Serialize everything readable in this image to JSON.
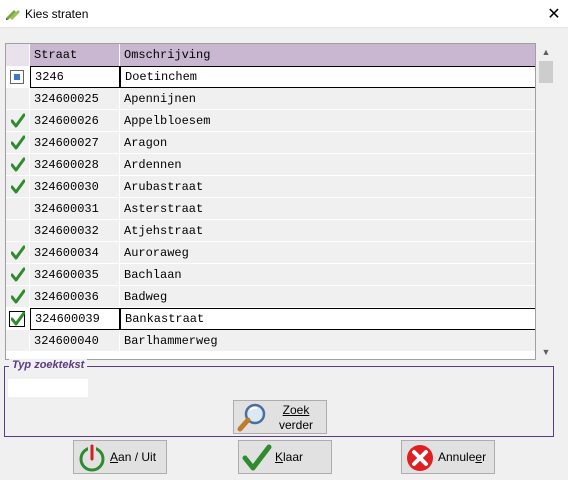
{
  "window": {
    "title": "Kies straten",
    "close_glyph": "✕"
  },
  "grid": {
    "columns": [
      "Straat",
      "Omschrijving"
    ],
    "rows": [
      {
        "straat": "3246",
        "omschrijving": "Doetinchem",
        "mark": "current"
      },
      {
        "straat": "324600025",
        "omschrijving": "Apennijnen",
        "mark": "none"
      },
      {
        "straat": "324600026",
        "omschrijving": "Appelbloesem",
        "mark": "check"
      },
      {
        "straat": "324600027",
        "omschrijving": "Aragon",
        "mark": "check"
      },
      {
        "straat": "324600028",
        "omschrijving": "Ardennen",
        "mark": "check"
      },
      {
        "straat": "324600030",
        "omschrijving": "Arubastraat",
        "mark": "check"
      },
      {
        "straat": "324600031",
        "omschrijving": "Asterstraat",
        "mark": "none"
      },
      {
        "straat": "324600032",
        "omschrijving": "Atjehstraat",
        "mark": "none"
      },
      {
        "straat": "324600034",
        "omschrijving": "Auroraweg",
        "mark": "check"
      },
      {
        "straat": "324600035",
        "omschrijving": "Bachlaan",
        "mark": "check"
      },
      {
        "straat": "324600036",
        "omschrijving": "Badweg",
        "mark": "check"
      },
      {
        "straat": "324600039",
        "omschrijving": "Bankastraat",
        "mark": "check-selected"
      },
      {
        "straat": "324600040",
        "omschrijving": "Barlhammerweg",
        "mark": "none"
      }
    ]
  },
  "search": {
    "legend": "Typ zoektekst",
    "value": "",
    "button_line1": "Zoek",
    "button_line2": "verder",
    "icon": "magnifier-icon"
  },
  "buttons": {
    "aan_uit": "Aan / Uit",
    "klaar": "Klaar",
    "annuleer": "Annuleer"
  },
  "colors": {
    "header_bg": "#c9b7d1",
    "check_green": "#2e8b2e",
    "cancel_red": "#e02020",
    "group_border": "#5b3a82"
  }
}
